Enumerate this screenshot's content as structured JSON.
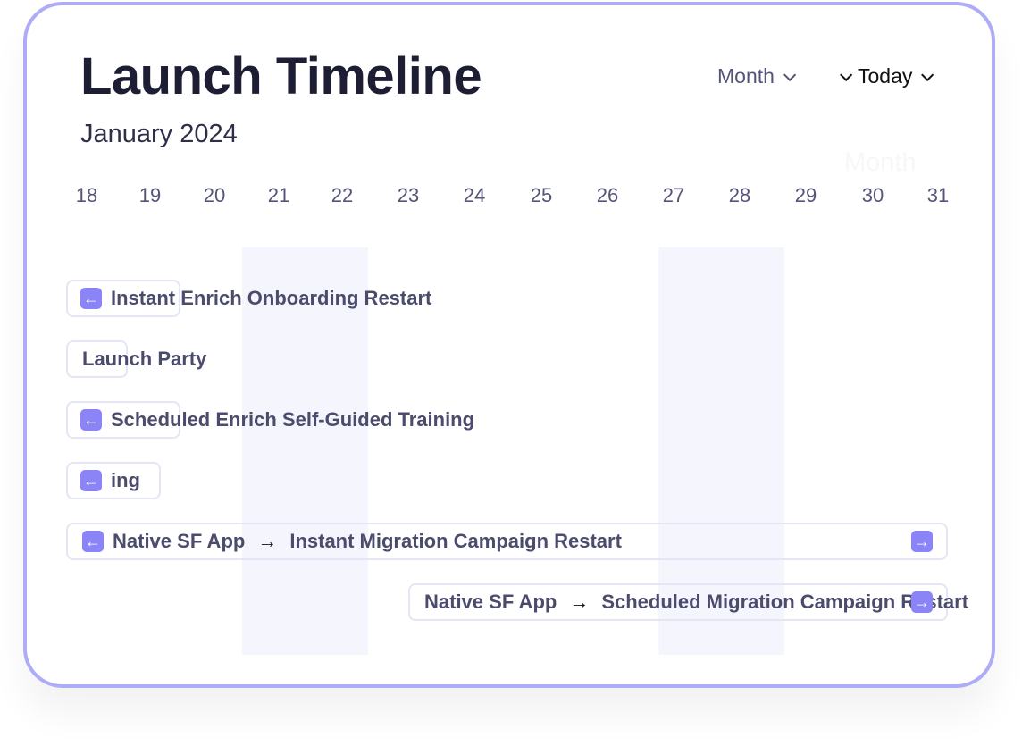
{
  "header": {
    "title": "Launch Timeline",
    "subtitle": "January 2024",
    "view_select": "Month",
    "today_button": "Today",
    "ghost_label": "Month"
  },
  "days": [
    "18",
    "19",
    "20",
    "21",
    "22",
    "23",
    "24",
    "25",
    "26",
    "27",
    "28",
    "29",
    "30",
    "31"
  ],
  "events": [
    {
      "label": "Instant Enrich Onboarding Restart",
      "icon_left": "arrow-left-icon"
    },
    {
      "label": "Launch Party"
    },
    {
      "label": "Scheduled Enrich Self-Guided Training",
      "icon_left": "arrow-left-icon"
    },
    {
      "label": "ing",
      "icon_left": "arrow-left-icon"
    },
    {
      "from": "Native SF App",
      "to": "Instant Migration Campaign Restart",
      "icon_left": "arrow-left-icon",
      "icon_right": "arrow-right-icon"
    },
    {
      "from": "Native SF App",
      "to": "Scheduled Migration Campaign Restart",
      "icon_right": "arrow-right-icon"
    }
  ],
  "colors": {
    "accent": "#8a84f7",
    "border": "#aeacf7",
    "weekend_band": "#f5f6fd",
    "text": "#4b4b6d"
  }
}
